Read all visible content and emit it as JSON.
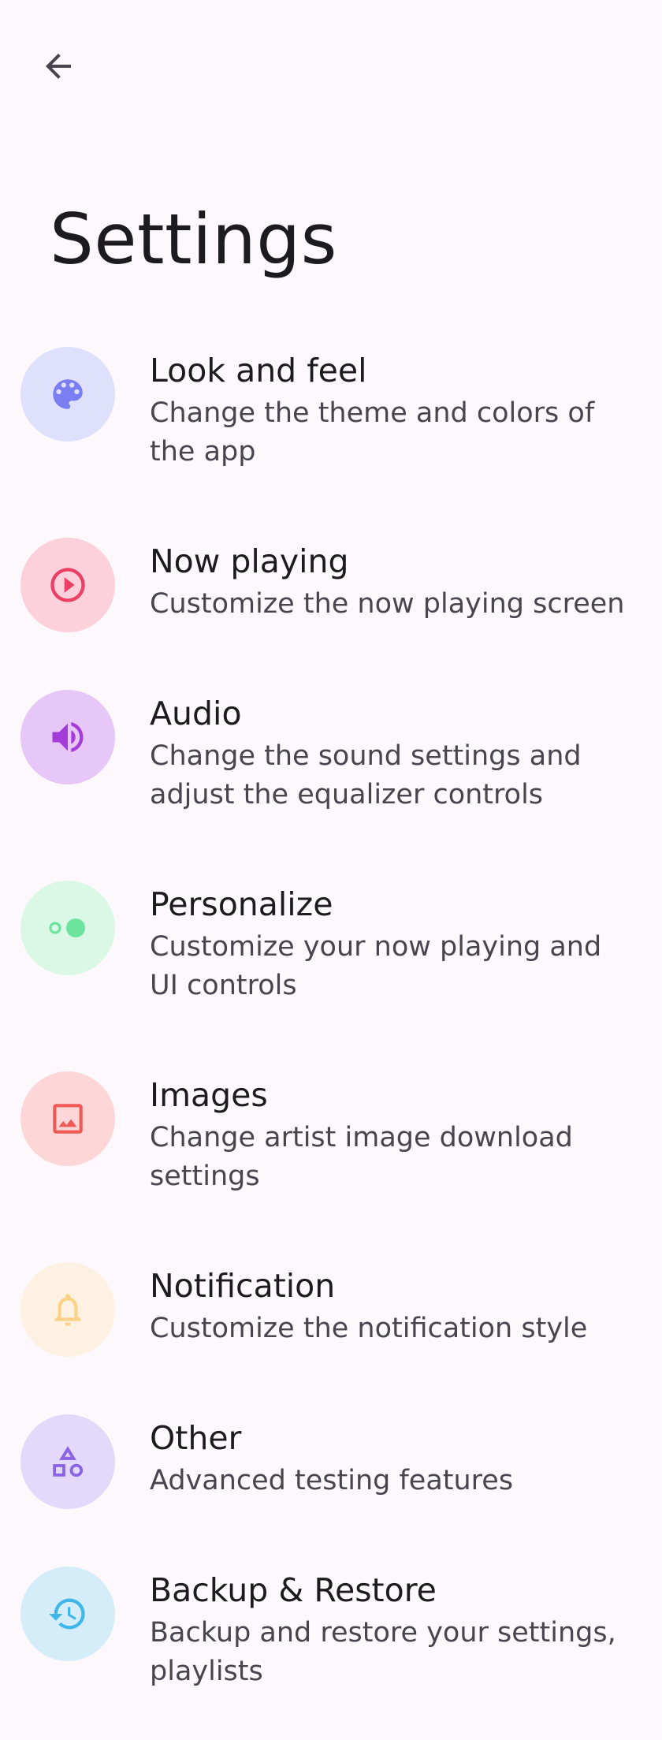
{
  "header": {
    "title": "Settings"
  },
  "colors": {
    "background": "#fdf8fc",
    "title": "#1c1b1f",
    "subtitle": "#49454f"
  },
  "settings": {
    "items": [
      {
        "title": "Look and feel",
        "subtitle": "Change the theme and colors of the app",
        "icon": "palette-icon",
        "icon_color": "#7b7ef2",
        "bg_color": "#dfe0fb"
      },
      {
        "title": "Now playing",
        "subtitle": "Customize the now playing screen",
        "icon": "play-circle-icon",
        "icon_color": "#ec3f63",
        "bg_color": "#fdd1dc"
      },
      {
        "title": "Audio",
        "subtitle": "Change the sound settings and adjust the equalizer controls",
        "icon": "volume-icon",
        "icon_color": "#a43dd8",
        "bg_color": "#e7c7f7"
      },
      {
        "title": "Personalize",
        "subtitle": "Customize your now playing and UI controls",
        "icon": "toggle-icon",
        "icon_color": "#6ce49e",
        "bg_color": "#dbf8e6"
      },
      {
        "title": "Images",
        "subtitle": "Change artist image download settings",
        "icon": "image-icon",
        "icon_color": "#ef5a56",
        "bg_color": "#fdd6d7"
      },
      {
        "title": "Notification",
        "subtitle": "Customize the notification style",
        "icon": "bell-icon",
        "icon_color": "#fbd287",
        "bg_color": "#fdf1e2"
      },
      {
        "title": "Other",
        "subtitle": "Advanced testing features",
        "icon": "shapes-icon",
        "icon_color": "#8a63e6",
        "bg_color": "#e3d9fb"
      },
      {
        "title": "Backup & Restore",
        "subtitle": "Backup and restore your settings, playlists",
        "icon": "restore-icon",
        "icon_color": "#3fb7e8",
        "bg_color": "#d5edf9"
      }
    ]
  }
}
